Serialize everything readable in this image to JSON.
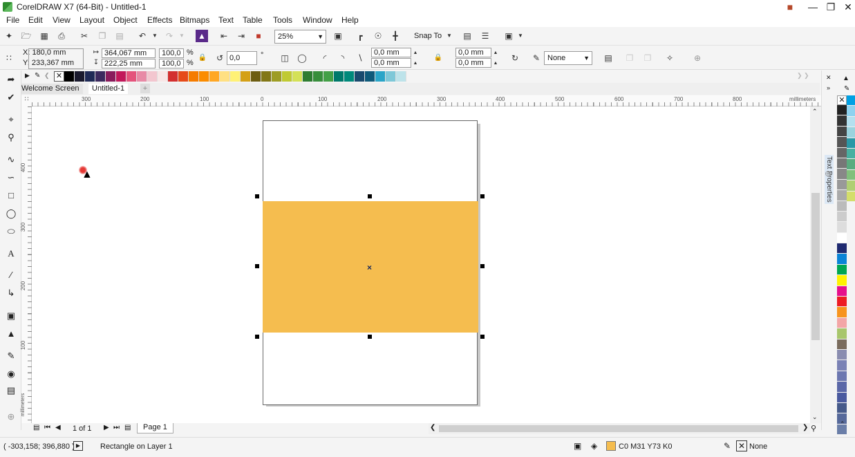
{
  "app": {
    "title": "CorelDRAW X7 (64-Bit) - Untitled-1"
  },
  "menu": [
    "File",
    "Edit",
    "View",
    "Layout",
    "Object",
    "Effects",
    "Bitmaps",
    "Text",
    "Table",
    "Tools",
    "Window",
    "Help"
  ],
  "standard_toolbar": {
    "zoom": "25%",
    "snap_to": "Snap To"
  },
  "property_bar": {
    "x": "X: 180,0 mm",
    "y": "Y: 233,367 mm",
    "width": "364,067 mm",
    "height": "222,25 mm",
    "scale_x": "100,0",
    "scale_y": "100,0",
    "percent": "%",
    "rotation": "0,0",
    "degree": "°",
    "corner_1": "0,0 mm",
    "corner_2": "0,0 mm",
    "corner_3": "0,0 mm",
    "corner_4": "0,0 mm",
    "outline": "None"
  },
  "tabs": [
    "Welcome Screen",
    "Untitled-1"
  ],
  "ruler_h": [
    "300",
    "200",
    "100",
    "0",
    "100",
    "200",
    "300",
    "400",
    "500",
    "600",
    "700",
    "800"
  ],
  "ruler_h_unit": "millimeters",
  "ruler_v": [
    "400",
    "300",
    "200",
    "100"
  ],
  "ruler_v_unit": "millimeters",
  "docker": {
    "label": "Text Properties"
  },
  "page_nav": {
    "count": "1 of 1",
    "page_tab": "Page 1"
  },
  "status": {
    "coords": "( -303,158; 396,880 )",
    "selection": "Rectangle on Layer 1",
    "fill_label": "C0 M31 Y73 K0",
    "outline_label": "None"
  },
  "colors": {
    "rectangle_fill": "#F5BD4F",
    "top_palette": [
      "#000000",
      "#1a1a2e",
      "#1f2a56",
      "#3c2a5e",
      "#8a1c5c",
      "#c2185b",
      "#e4537c",
      "#e88aa6",
      "#f3c6cf",
      "#f8e6e6",
      "#d32f2f",
      "#e64a19",
      "#f57c00",
      "#fb8c00",
      "#ffa726",
      "#ffe082",
      "#fff176",
      "#d4a017",
      "#6d5d12",
      "#827717",
      "#9e9d24",
      "#c0ca33",
      "#d4e157",
      "#2e7d32",
      "#388e3c",
      "#43a047",
      "#00796b",
      "#00897b",
      "#1a4a6e",
      "#0f5a7a",
      "#2aa5c8",
      "#7ec8d8",
      "#bde3ea"
    ],
    "right_palette": [
      "#222",
      "#333",
      "#444",
      "#555",
      "#666",
      "#777",
      "#888",
      "#999",
      "#aaa",
      "#bbb",
      "#ccc",
      "#ddd",
      "#fff",
      "#1f2a70",
      "#0a84d6",
      "#00a651",
      "#fff200",
      "#e60f8c",
      "#ed1c24",
      "#f7941d",
      "#f3a6a6",
      "#a8c66c",
      "#7a6c5d",
      "#8a8db0",
      "#7a82b5",
      "#6c77b0",
      "#5b68a8",
      "#4a5a9f",
      "#465a8a",
      "#56699a",
      "#6a7ea8"
    ],
    "right_palette_2": [
      "#00a0e3",
      "#8fd2ef",
      "#b4e0ef",
      "#9ad3de",
      "#2a98a6",
      "#49b0a1",
      "#5aac80",
      "#81c07c",
      "#b0cf73",
      "#d4de6b"
    ]
  }
}
